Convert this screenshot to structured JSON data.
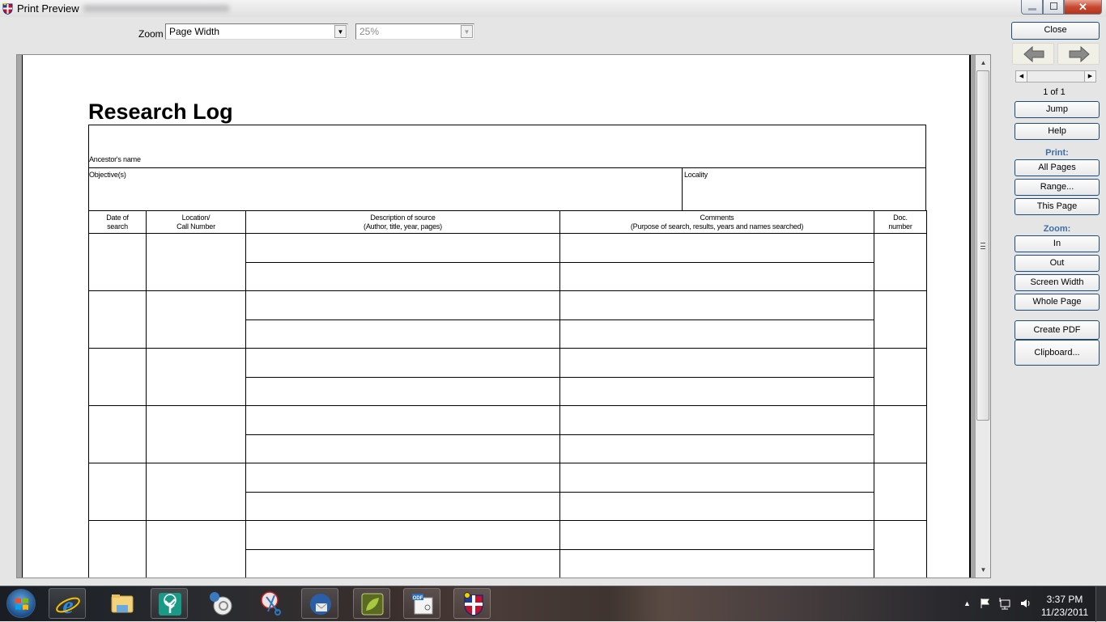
{
  "window": {
    "title": "Print Preview",
    "controls": {
      "minimize": "minimize",
      "maximize": "restore",
      "close": "✕"
    }
  },
  "toolbar": {
    "zoom_label": "Zoom",
    "zoom_mode": {
      "selected": "Page Width"
    },
    "zoom_percent": {
      "selected": "25%",
      "enabled": false
    }
  },
  "document": {
    "title": "Research Log",
    "header_fields": {
      "ancestor": "Ancestor's name",
      "objective": "Objective(s)",
      "locality": "Locality"
    },
    "table": {
      "columns": [
        {
          "line1": "Date of",
          "line2": "search"
        },
        {
          "line1": "Location/",
          "line2": "Call Number"
        },
        {
          "line1": "Description of source",
          "line2": "(Author, title, year, pages)"
        },
        {
          "line1": "Comments",
          "line2": "(Purpose of search, results, years and names searched)"
        },
        {
          "line1": "Doc.",
          "line2": "number"
        }
      ],
      "visible_entry_groups": 6
    }
  },
  "side_panel": {
    "close": "Close",
    "page_indicator": "1 of 1",
    "jump": "Jump",
    "help": "Help",
    "print_section": "Print:",
    "print_all": "All Pages",
    "print_range": "Range...",
    "print_this": "This Page",
    "zoom_section": "Zoom:",
    "zoom_in": "In",
    "zoom_out": "Out",
    "zoom_screen_width": "Screen Width",
    "zoom_whole_page": "Whole Page",
    "create_pdf": "Create PDF",
    "clipboard": "Clipboard..."
  },
  "taskbar": {
    "apps": [
      {
        "name": "internet-explorer",
        "icon": "ie-icon"
      },
      {
        "name": "windows-explorer",
        "icon": "folder-icon"
      },
      {
        "name": "family-tree",
        "icon": "tree-icon"
      },
      {
        "name": "media-app",
        "icon": "media-icon"
      },
      {
        "name": "snipping-tool",
        "icon": "scissors-icon"
      },
      {
        "name": "thunderbird",
        "icon": "mail-icon"
      },
      {
        "name": "leaf-app",
        "icon": "leaf-icon"
      },
      {
        "name": "odf-app",
        "icon": "odf-icon"
      },
      {
        "name": "print-preview-app",
        "icon": "shield-icon"
      }
    ],
    "clock": {
      "time": "3:37 PM",
      "date": "11/23/2011"
    }
  }
}
